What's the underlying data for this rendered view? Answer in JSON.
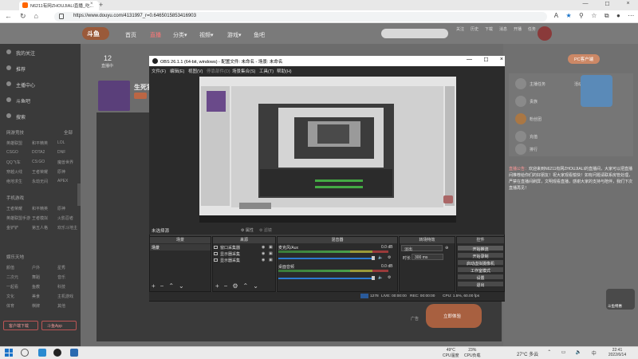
{
  "browser": {
    "tab_title": "N6211有网ZHOUJIALI直播_吃...",
    "tab_close": "×",
    "new_tab": "+",
    "url": "https://www.douyu.com/4131997_r=0.6465015853416903",
    "win_controls": [
      "—",
      "☐",
      "×"
    ]
  },
  "site": {
    "logo": "斗鱼",
    "nav": [
      "首页",
      "直播",
      "分类▾",
      "视频▾",
      "游戏▾",
      "鱼吧"
    ],
    "header_icons": [
      "关注",
      "历史",
      "下载",
      "消息",
      "开播",
      "任务"
    ],
    "sidebar": {
      "items": [
        "我的关注",
        "推荐",
        "主播中心",
        "斗鱼吧",
        "搜索"
      ],
      "section1": "网游竞技",
      "section1_more": "全部",
      "grid1": [
        "英雄联盟",
        "和平精英",
        "LOL",
        "CSGO",
        "DOTA2",
        "DNF",
        "QQ飞车",
        "CS:GO",
        "魔兽世界",
        "穿越火线",
        "王者荣耀",
        "原神",
        "绝地求生",
        "永劫无间",
        "APEX"
      ],
      "section2": "手机游戏",
      "grid2": [
        "王者荣耀",
        "和平精英",
        "原神",
        "英雄联盟手游",
        "王者模拟",
        "火影忍者",
        "金铲铲",
        "第五人格",
        "欢乐斗地主"
      ],
      "section3": "娱乐天地",
      "grid3": [
        "颜值",
        "户外",
        "星秀",
        "二次元",
        "舞蹈",
        "音乐",
        "一起看",
        "鱼教",
        "科技",
        "文化",
        "美食",
        "主机游戏",
        "体育",
        "棋牌",
        "其他"
      ],
      "btn1": "客户端下载",
      "btn2": "斗鱼App"
    },
    "count": "12",
    "count_label": "直播中",
    "stream_title": "生死狙击",
    "ad_label": "广告",
    "ad_button": "立即体验",
    "pc_button": "PC客户端",
    "right_items": [
      "主播任务",
      "贵族",
      "粉丝团",
      "充值",
      "排行",
      "活动"
    ],
    "right_text_label": "直播公告：",
    "right_text": "欢迎来到N6211有网ZHOUJIALI的直播间，大家可以把直播间推荐给你们的好朋友！祝大家观看愉快！如有问题请联系房管处理，严禁在直播间刷屏，文明观看直播，感谢大家的支持与陪伴，我们下次直播再见！",
    "float_badge": "斗鱼特惠"
  },
  "obs": {
    "title": "OBS 26.1.1 (64-bit, windows) - 配置文件: 未命名 - 场景: 未命名",
    "menu": [
      "文件(F)",
      "编辑(E)",
      "视图(V)",
      "停靠部件(D)",
      "场景集合(S)",
      "工具(T)",
      "帮助(H)"
    ],
    "scene_bar_label": "未选择源",
    "props_btn": "属性",
    "filters_btn": "滤镜",
    "panels": {
      "scenes": "场景",
      "sources": "来源",
      "mixer": "混音器",
      "transitions": "转场特效",
      "controls": "控件"
    },
    "scene_name": "场景",
    "sources": [
      "窗口采集器",
      "显示器采集",
      "显示器采集"
    ],
    "mixer": [
      {
        "name": "麦克风/Aux",
        "db": "0.0 dB"
      },
      {
        "name": "桌面音频",
        "db": "0.0 dB"
      }
    ],
    "transition": "淡出",
    "duration_label": "时长",
    "duration": "300 ms",
    "controls": [
      "开始推流",
      "开始录制",
      "启动虚拟摄像机",
      "工作室模式",
      "设置",
      "退出"
    ],
    "status": {
      "live": "LIVE: 00:00:00",
      "rec": "REC: 00:00:00",
      "cpu": "CPU: 1.5%, 60.00 fps",
      "dropped": "1278"
    }
  },
  "taskbar": {
    "cpu_temp_val": "49°C",
    "cpu_temp_lbl": "CPU温度",
    "cpu_use_val": "23%",
    "cpu_use_lbl": "CPU负载",
    "weather": "27°C 多云",
    "time": "22:41",
    "date": "2022/6/14"
  }
}
